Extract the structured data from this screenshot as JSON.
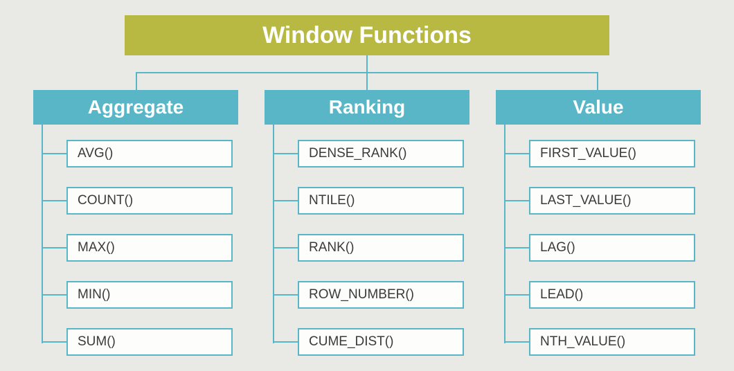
{
  "root_title": "Window Functions",
  "categories": [
    {
      "name": "Aggregate",
      "items": [
        "AVG()",
        "COUNT()",
        "MAX()",
        "MIN()",
        "SUM()"
      ]
    },
    {
      "name": "Ranking",
      "items": [
        "DENSE_RANK()",
        "NTILE()",
        "RANK()",
        "ROW_NUMBER()",
        "CUME_DIST()"
      ]
    },
    {
      "name": "Value",
      "items": [
        "FIRST_VALUE()",
        "LAST_VALUE()",
        "LAG()",
        "LEAD()",
        "NTH_VALUE()"
      ]
    }
  ],
  "colors": {
    "root_bg": "#b7b942",
    "category_bg": "#58b6c6",
    "line": "#58b6c6",
    "page_bg": "#e9e9e6",
    "item_border": "#58b6c6"
  }
}
